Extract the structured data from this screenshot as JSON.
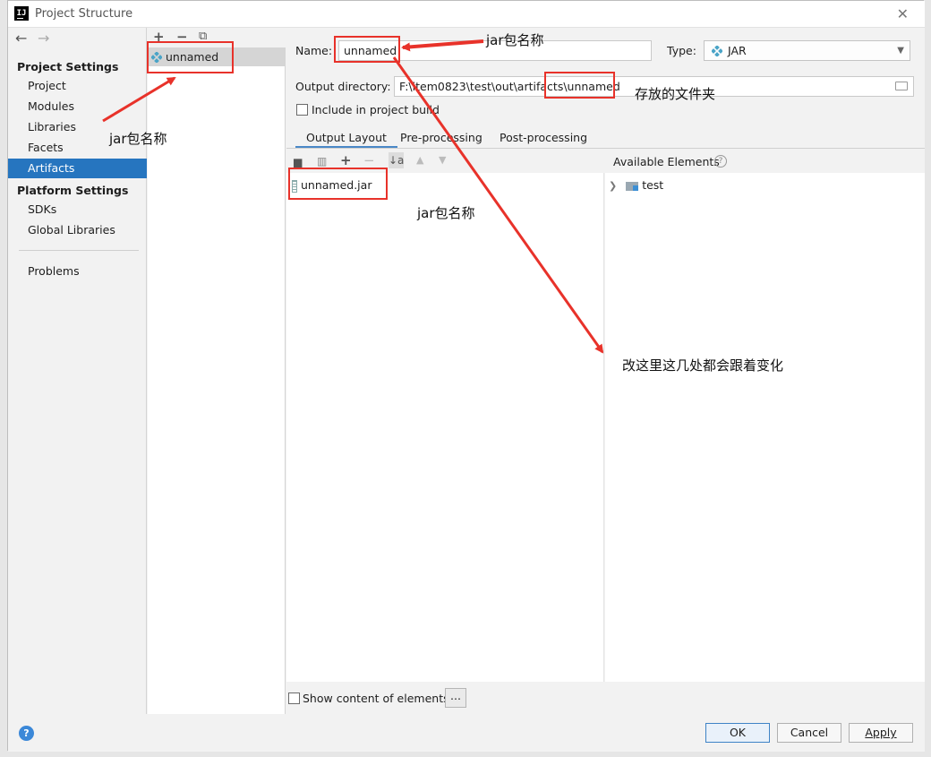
{
  "window": {
    "title": "Project Structure"
  },
  "nav": {
    "back": "←",
    "forward": "→",
    "project_settings_header": "Project Settings",
    "project_settings": [
      "Project",
      "Modules",
      "Libraries",
      "Facets",
      "Artifacts"
    ],
    "platform_settings_header": "Platform Settings",
    "platform_settings": [
      "SDKs",
      "Global Libraries"
    ],
    "problems": "Problems",
    "selected": "Artifacts"
  },
  "artifact_toolbar": {
    "add": "+",
    "remove": "−",
    "copy": "⧉"
  },
  "artifacts": [
    {
      "name": "unnamed"
    }
  ],
  "config": {
    "name_label": "Name:",
    "name_value": "unnamed",
    "type_label": "Type:",
    "type_value": "JAR",
    "output_dir_label": "Output directory:",
    "output_dir_value": "F:\\item0823\\test\\out\\artifacts\\unnamed",
    "include_in_build_label": "Include in project build",
    "include_in_build_checked": false,
    "tabs": [
      "Output Layout",
      "Pre-processing",
      "Post-processing"
    ],
    "active_tab": "Output Layout",
    "layout_items": [
      "unnamed.jar"
    ],
    "available_label": "Available Elements",
    "available_items": [
      "test"
    ],
    "show_content_label": "Show content of elements",
    "show_content_checked": false,
    "more_button": "..."
  },
  "buttons": {
    "ok": "OK",
    "cancel": "Cancel",
    "apply": "Apply",
    "help": "?"
  },
  "annotations": {
    "jar_name_1": "jar包名称",
    "jar_name_2": "jar包名称",
    "jar_name_3": "jar包名称",
    "folder_note": "存放的文件夹",
    "change_note": "改这里这几处都会跟着变化"
  },
  "colors": {
    "selection": "#2675bf",
    "annotation": "#e8322a",
    "jar_icon": "#4aa4c7"
  }
}
